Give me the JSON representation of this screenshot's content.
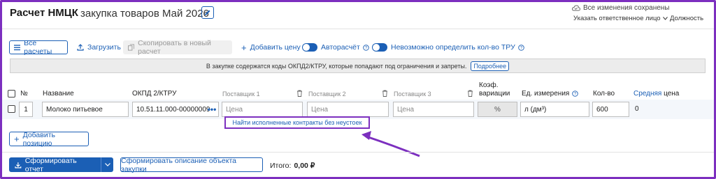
{
  "header": {
    "title": "Расчет НМЦК",
    "subtitle": "закупка товаров Май 2026",
    "saved_status": "Все изменения сохранены",
    "responsible_label": "Указать ответственное лицо",
    "position_label": "Должность"
  },
  "toolbar": {
    "all_calcs": "Все расчеты",
    "load": "Загрузить",
    "copy": "Скопировать в новый расчет",
    "add_price": "Добавить цену",
    "autocalc": "Авторасчёт",
    "cannot_determine": "Невозможно определить кол-во ТРУ"
  },
  "warning": {
    "text": "В закупке содержатся коды ОКПД2/КТРУ, которые попадают под ограничения и запреты.",
    "link": "Подробнее"
  },
  "table": {
    "headers": {
      "num": "№",
      "name": "Название",
      "okpd": "ОКПД 2/КТРУ",
      "supplier1": "Поставщик 1",
      "supplier2": "Поставщик 2",
      "supplier3": "Поставщик 3",
      "coef_line1": "Коэф.",
      "coef_line2": "вариации",
      "unit": "Ед. измерения",
      "qty": "Кол-во",
      "avg_link": "Средняя",
      "avg_rest": "цена"
    },
    "row": {
      "num": "1",
      "name": "Молоко питьевое",
      "okpd": "10.51.11.000-00000009",
      "price_placeholder": "Цена",
      "coef": "%",
      "unit": "л (дм³)",
      "qty": "600",
      "avg": "0"
    },
    "popup": "Найти исполненные контракты без неустоек"
  },
  "footer": {
    "add_position": "Добавить позицию",
    "generate_report": "Сформировать отчет",
    "generate_description": "Сформировать описание объекта закупки",
    "total_label": "Итого:",
    "total_value": "0,00 ₽"
  },
  "colors": {
    "accent": "#1b5fb5",
    "highlight": "#7c2fbf"
  }
}
